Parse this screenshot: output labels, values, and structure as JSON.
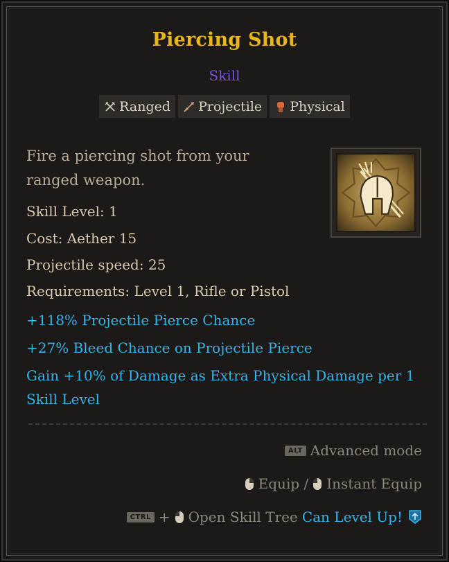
{
  "tooltip": {
    "title": "Piercing Shot",
    "subtitle": "Skill",
    "tags": [
      {
        "label": "Ranged",
        "icon": "crossed-swords-icon"
      },
      {
        "label": "Projectile",
        "icon": "arrow-icon"
      },
      {
        "label": "Physical",
        "icon": "fist-icon"
      }
    ],
    "description": "Fire a piercing shot from your ranged weapon.",
    "skill_icon": "helmet-icon",
    "stats": [
      "Skill Level: 1",
      "Cost: Aether 15",
      "Projectile speed: 25",
      "Requirements: Level 1, Rifle or Pistol"
    ],
    "modifiers": [
      "+118% Projectile Pierce Chance",
      "+27% Bleed Chance on Projectile Pierce",
      "Gain +10% of Damage as Extra Physical Damage per 1 Skill Level"
    ],
    "hints": {
      "alt_key": "ALT",
      "advanced_mode": "Advanced mode",
      "equip": "Equip /",
      "instant_equip": "Instant Equip",
      "ctrl_key": "CTRL",
      "plus": "+",
      "open_tree": "Open Skill Tree",
      "level_up": "Can Level Up!"
    },
    "colors": {
      "title": "#e9b51d",
      "subtitle": "#7a52d8",
      "modifier": "#35b4ea",
      "stat": "#d8c9aa"
    }
  }
}
